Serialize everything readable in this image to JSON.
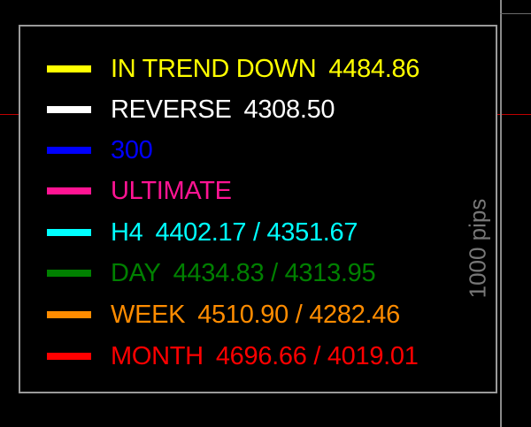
{
  "colors": {
    "background": "#000000",
    "price_line": "#c00000",
    "border": "#9a9a9a",
    "scale_label": "#777777"
  },
  "legend": {
    "items": [
      {
        "label": "IN TREND DOWN",
        "value": "4484.86",
        "color": "#ffff00"
      },
      {
        "label": "REVERSE",
        "value": "4308.50",
        "color": "#ffffff"
      },
      {
        "label": "300",
        "value": "",
        "color": "#0000ff"
      },
      {
        "label": "ULTIMATE",
        "value": "",
        "color": "#ff1493"
      },
      {
        "label": "H4",
        "value": "4402.17 / 4351.67",
        "color": "#00ffff"
      },
      {
        "label": "DAY",
        "value": "4434.83 / 4313.95",
        "color": "#008000"
      },
      {
        "label": "WEEK",
        "value": "4510.90 / 4282.46",
        "color": "#ff8c00"
      },
      {
        "label": "MONTH",
        "value": "4696.66 / 4019.01",
        "color": "#ff0000"
      }
    ]
  },
  "scale": {
    "label": "1000 pips"
  }
}
